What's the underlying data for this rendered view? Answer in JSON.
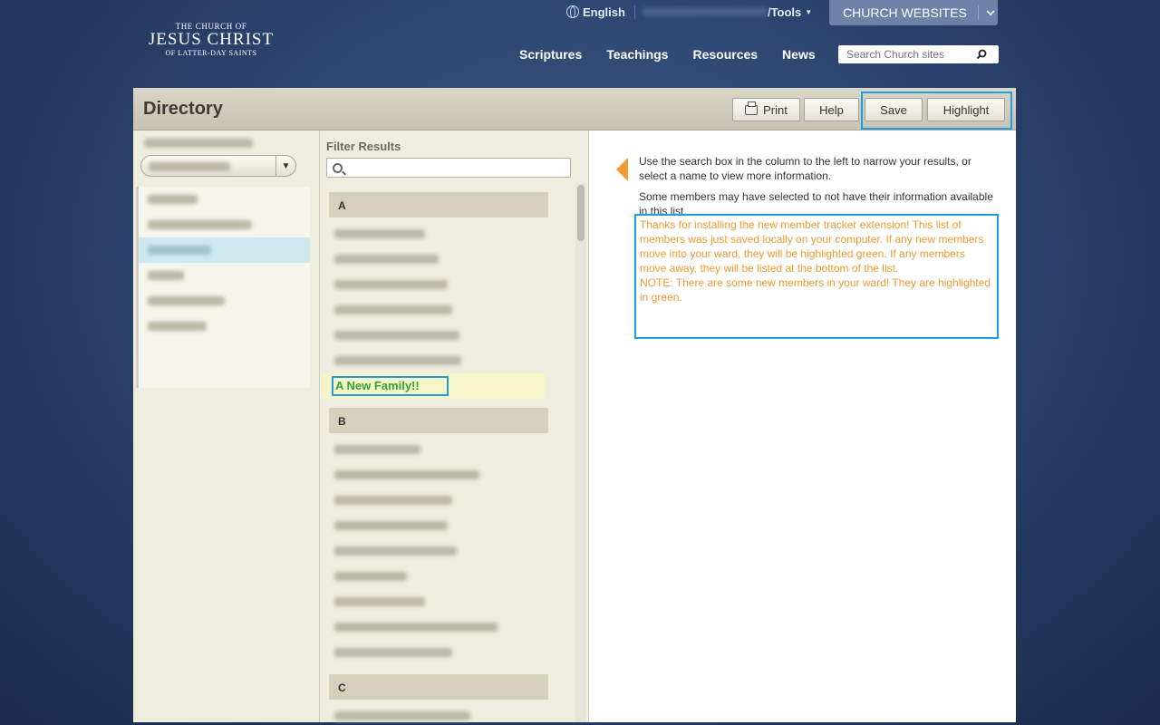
{
  "header": {
    "logo": {
      "line1": "THE CHURCH OF",
      "line2": "JESUS CHRIST",
      "line3": "OF LATTER-DAY SAINTS"
    },
    "language": "English",
    "tools": "/Tools",
    "church_websites": "CHURCH WEBSITES",
    "nav": [
      "Scriptures",
      "Teachings",
      "Resources",
      "News"
    ],
    "search_placeholder": "Search Church sites"
  },
  "directory": {
    "title": "Directory",
    "buttons": {
      "print": "Print",
      "help": "Help",
      "save": "Save",
      "highlight": "Highlight"
    },
    "filter_label": "Filter Results",
    "sections": [
      "A",
      "B",
      "C"
    ],
    "new_family": "A New Family!!",
    "info": {
      "line1": "Use the search box in the column to the left to narrow your results, or select a name to view more information.",
      "line2": "Some members may have selected to not have their information available in this list.",
      "extension_message": "Thanks for installing the new member tracker extension! This list of members was just saved locally on your computer. If any new members move into your ward, they will be highlighted green. If any members move away, they will be listed at the bottom of the list.",
      "note": "NOTE: There are some new members in your ward! They are highlighted in green."
    }
  },
  "colors": {
    "accent_blue": "#1f9fe0",
    "message_orange": "#f29a33",
    "new_green": "#2fa52f",
    "highlight_yellow": "#f7f4c8"
  }
}
